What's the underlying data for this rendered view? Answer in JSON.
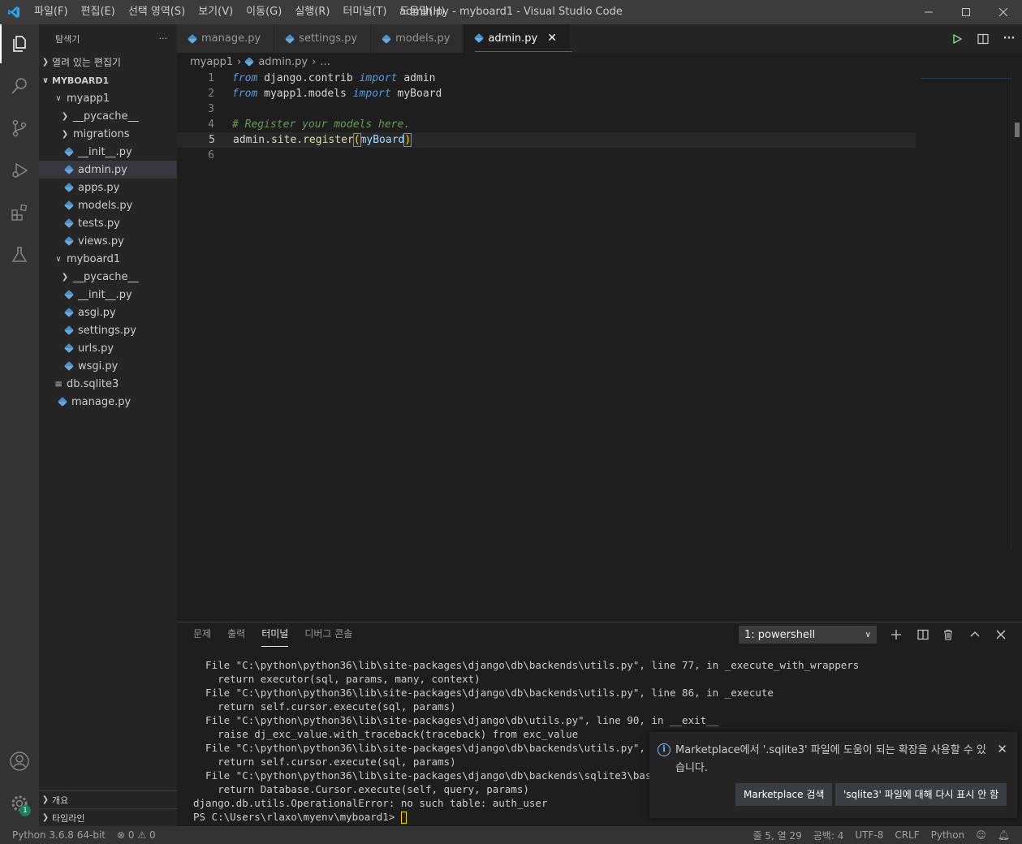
{
  "titlebar": {
    "menu": [
      "파일(F)",
      "편집(E)",
      "선택 영역(S)",
      "보기(V)",
      "이동(G)",
      "실행(R)",
      "터미널(T)",
      "도움말(H)"
    ],
    "title": "admin.py - myboard1 - Visual Studio Code"
  },
  "sidebar": {
    "header": "탐색기",
    "more": "···",
    "open_editors": "열려 있는 편집기",
    "workspace": "MYBOARD1",
    "tree": [
      {
        "label": "myapp1",
        "type": "folder-open"
      },
      {
        "label": "__pycache__",
        "type": "folder"
      },
      {
        "label": "migrations",
        "type": "folder"
      },
      {
        "label": "__init__.py",
        "type": "py"
      },
      {
        "label": "admin.py",
        "type": "py"
      },
      {
        "label": "apps.py",
        "type": "py"
      },
      {
        "label": "models.py",
        "type": "py"
      },
      {
        "label": "tests.py",
        "type": "py"
      },
      {
        "label": "views.py",
        "type": "py"
      },
      {
        "label": "myboard1",
        "type": "folder-open"
      },
      {
        "label": "__pycache__",
        "type": "folder"
      },
      {
        "label": "__init__.py",
        "type": "py"
      },
      {
        "label": "asgi.py",
        "type": "py"
      },
      {
        "label": "settings.py",
        "type": "py"
      },
      {
        "label": "urls.py",
        "type": "py"
      },
      {
        "label": "wsgi.py",
        "type": "py"
      },
      {
        "label": "db.sqlite3",
        "type": "db"
      },
      {
        "label": "manage.py",
        "type": "py"
      }
    ],
    "outline": "개요",
    "timeline": "타임라인"
  },
  "tabs": [
    "manage.py",
    "settings.py",
    "models.py",
    "admin.py"
  ],
  "active_tab": "admin.py",
  "breadcrumb": {
    "folder": "myapp1",
    "file": "admin.py",
    "more": "..."
  },
  "code": {
    "line_numbers": [
      "1",
      "2",
      "3",
      "4",
      "5",
      "6"
    ],
    "l1": {
      "kw1": "from",
      "mod": " django.contrib ",
      "kw2": "import",
      "name": " admin"
    },
    "l2": {
      "kw1": "from",
      "mod": " myapp1.models ",
      "kw2": "import",
      "name": " myBoard"
    },
    "l4": "# Register your models here.",
    "l5": {
      "obj": "admin",
      "dot1": ".",
      "site": "site",
      "dot2": ".",
      "fn": "register",
      "open": "(",
      "arg": "myBoard",
      "close": ")"
    }
  },
  "panel": {
    "tabs": [
      "문제",
      "출력",
      "터미널",
      "디버그 콘솔"
    ],
    "active_tab": "터미널",
    "terminal_select": "1: powershell",
    "terminal_lines": [
      "  File \"C:\\python\\python36\\lib\\site-packages\\django\\db\\backends\\utils.py\", line 77, in _execute_with_wrappers",
      "    return executor(sql, params, many, context)",
      "  File \"C:\\python\\python36\\lib\\site-packages\\django\\db\\backends\\utils.py\", line 86, in _execute",
      "    return self.cursor.execute(sql, params)",
      "  File \"C:\\python\\python36\\lib\\site-packages\\django\\db\\utils.py\", line 90, in __exit__",
      "    raise dj_exc_value.with_traceback(traceback) from exc_value",
      "  File \"C:\\python\\python36\\lib\\site-packages\\django\\db\\backends\\utils.py\", line 8",
      "    return self.cursor.execute(sql, params)",
      "  File \"C:\\python\\python36\\lib\\site-packages\\django\\db\\backends\\sqlite3\\base.py\",",
      "    return Database.Cursor.execute(self, query, params)",
      "django.db.utils.OperationalError: no such table: auth_user"
    ],
    "prompt": "PS C:\\Users\\rlaxo\\myenv\\myboard1> "
  },
  "notification": {
    "message": "Marketplace에서 '.sqlite3' 파일에 도움이 되는 확장을 사용할 수 있습니다.",
    "button_search": "Marketplace 검색",
    "button_dismiss": "'sqlite3' 파일에 대해 다시 표시 안 함"
  },
  "statusbar": {
    "python": "Python 3.6.8 64-bit",
    "errors": "0",
    "warnings": "0",
    "position": "줄 5, 열 29",
    "spaces": "공백: 4",
    "encoding": "UTF-8",
    "eol": "CRLF",
    "language": "Python"
  },
  "activity": {
    "settings_badge": "1"
  },
  "colors": {
    "accent": "#007acc",
    "title_bg": "#3c3c3c",
    "editor_bg": "#1e1e1e"
  }
}
